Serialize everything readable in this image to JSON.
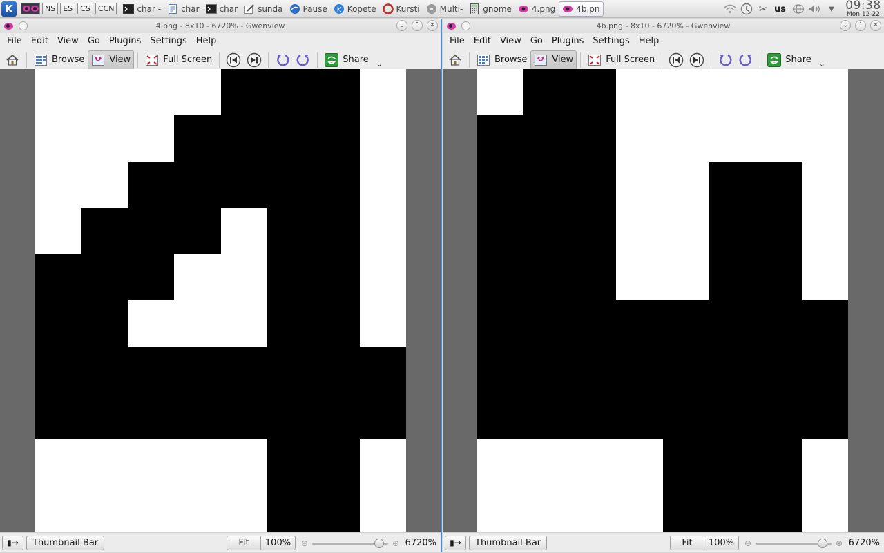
{
  "taskbar": {
    "desktops": [
      "NS",
      "ES",
      "CS",
      "CCN"
    ],
    "tasks": [
      {
        "label": "char -",
        "icon": "terminal-icon",
        "color": "#333333",
        "active": false
      },
      {
        "label": "char",
        "icon": "document-icon",
        "color": "#5a7fc0",
        "active": false
      },
      {
        "label": "char",
        "icon": "terminal-icon",
        "color": "#777777",
        "active": false
      },
      {
        "label": "sunda",
        "icon": "edit-icon",
        "color": "#555555",
        "active": false
      },
      {
        "label": "Pause",
        "icon": "browser-icon",
        "color": "#2c6fc2",
        "active": false
      },
      {
        "label": "Kopete",
        "icon": "kopete-icon",
        "color": "#2f80d8",
        "active": false
      },
      {
        "label": "Kursti",
        "icon": "audio-icon",
        "color": "#c0302a",
        "active": false
      },
      {
        "label": "Multi-",
        "icon": "disk-icon",
        "color": "#9a9a9a",
        "active": false
      },
      {
        "label": "gnome",
        "icon": "calculator-icon",
        "color": "#555555",
        "active": false
      },
      {
        "label": "4.png",
        "icon": "gwenview-icon",
        "color": "#d43a9b",
        "active": false
      },
      {
        "label": "4b.pn",
        "icon": "gwenview-icon",
        "color": "#d43a9b",
        "active": true
      }
    ],
    "keyboard_layout": "us",
    "clock_time": "09:38",
    "clock_date": "Mon 12-22"
  },
  "windows": [
    {
      "id": "left",
      "title": "4.png - 8x10 - 6720% - Gwenview",
      "menus": [
        "File",
        "Edit",
        "View",
        "Go",
        "Plugins",
        "Settings",
        "Help"
      ],
      "toolbar": {
        "browse": "Browse",
        "view": "View",
        "fullscreen": "Full Screen",
        "share": "Share"
      },
      "image_pixels": [
        "WWWWBBBW",
        "WWWBBBBW",
        "WWBBBBBW",
        "WBBBWBBW",
        "BBBWWBBW",
        "BBWWWBBW",
        "BBBBBBBB",
        "BBBBBBBB",
        "WWWWWBBW",
        "WWWWWBBW"
      ],
      "status": {
        "thumbnail_bar": "Thumbnail Bar",
        "fit": "Fit",
        "actual": "100%",
        "zoom": "6720%",
        "zoom_level": 0.88
      }
    },
    {
      "id": "right",
      "title": "4b.png - 8x10 - 6720% - Gwenview",
      "menus": [
        "File",
        "Edit",
        "View",
        "Go",
        "Plugins",
        "Settings",
        "Help"
      ],
      "toolbar": {
        "browse": "Browse",
        "view": "View",
        "fullscreen": "Full Screen",
        "share": "Share"
      },
      "image_pixels": [
        "WBBWWWWW",
        "BBBWWWWW",
        "BBBWWBBW",
        "BBBWWBBW",
        "BBBWWBBW",
        "BBBBBBBB",
        "BBBBBBBB",
        "BBBBBBBB",
        "WWWWBBBW",
        "WWWWBBBW"
      ],
      "status": {
        "thumbnail_bar": "Thumbnail Bar",
        "fit": "Fit",
        "actual": "100%",
        "zoom": "6720%",
        "zoom_level": 0.88
      }
    }
  ]
}
